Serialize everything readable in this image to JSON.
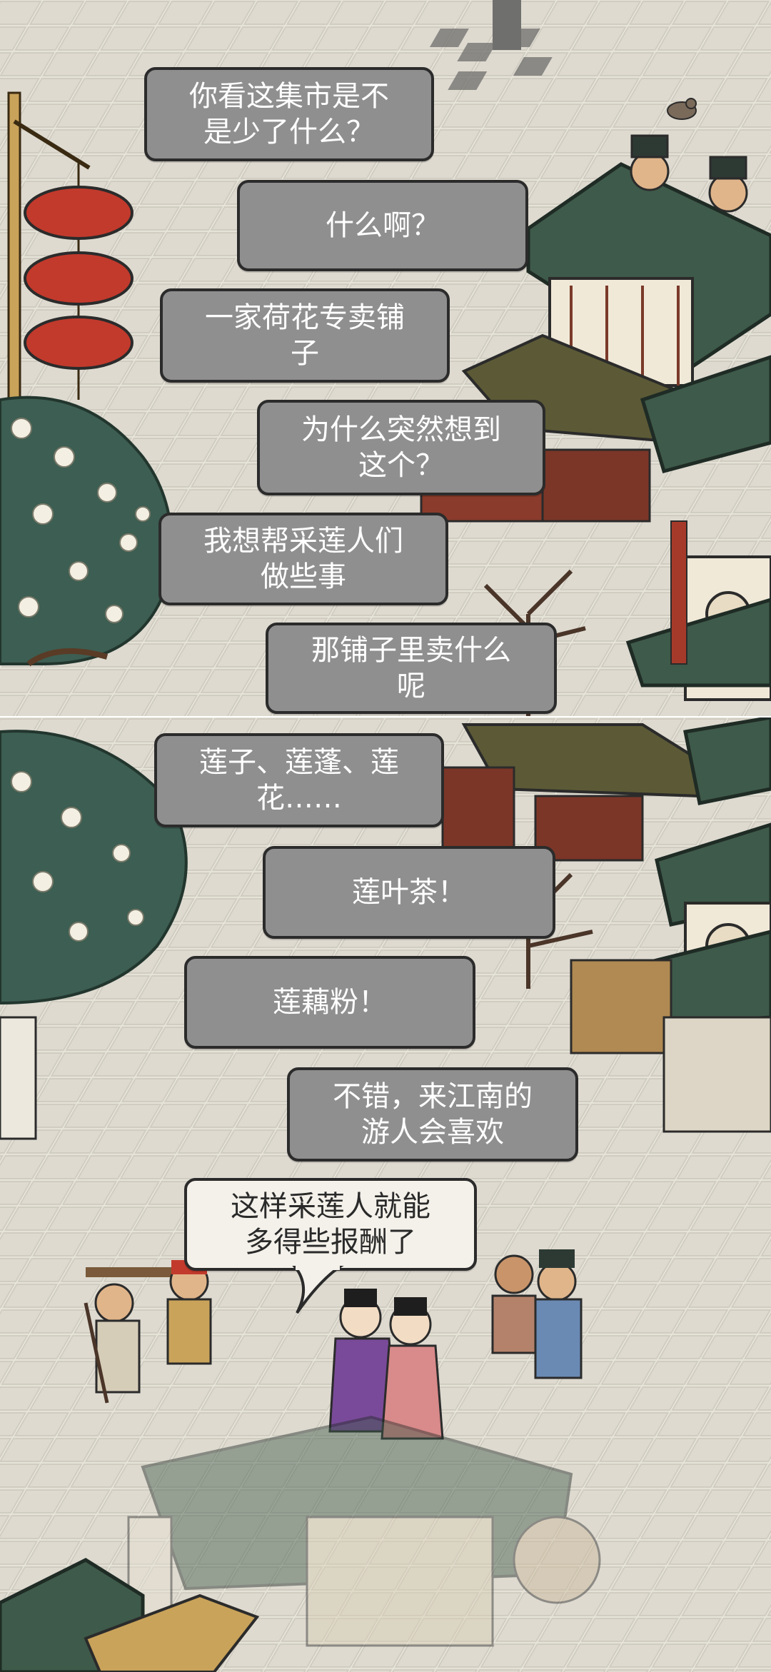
{
  "dialogue_top": [
    {
      "id": "l1",
      "text": "你看这集市是不\n是少了什么？"
    },
    {
      "id": "l2",
      "text": "什么啊？"
    },
    {
      "id": "l3",
      "text": "一家荷花专卖铺\n子"
    },
    {
      "id": "l4",
      "text": "为什么突然想到\n这个？"
    },
    {
      "id": "l5",
      "text": "我想帮采莲人们\n做些事"
    },
    {
      "id": "l6",
      "text": "那铺子里卖什么\n呢"
    }
  ],
  "dialogue_bottom": [
    {
      "id": "l7",
      "text": "莲子、莲蓬、莲\n花……"
    },
    {
      "id": "l8",
      "text": "莲叶茶！"
    },
    {
      "id": "l9",
      "text": "莲藕粉！"
    },
    {
      "id": "l10",
      "text": "不错，来江南的\n游人会喜欢"
    },
    {
      "id": "l11",
      "text": "这样采莲人就能\n多得些报酬了"
    }
  ],
  "colors": {
    "bubble_fill": "#8f8f8f",
    "speech_fill": "#f4f1ea",
    "outline": "#2b2b2b",
    "roof_green": "#3e5a4a",
    "umbrella_red": "#c23a2c",
    "ground": "#e9e6dc"
  },
  "icons": [
    "red-umbrella-icon",
    "pigeon-icon",
    "flower-tree-icon"
  ]
}
